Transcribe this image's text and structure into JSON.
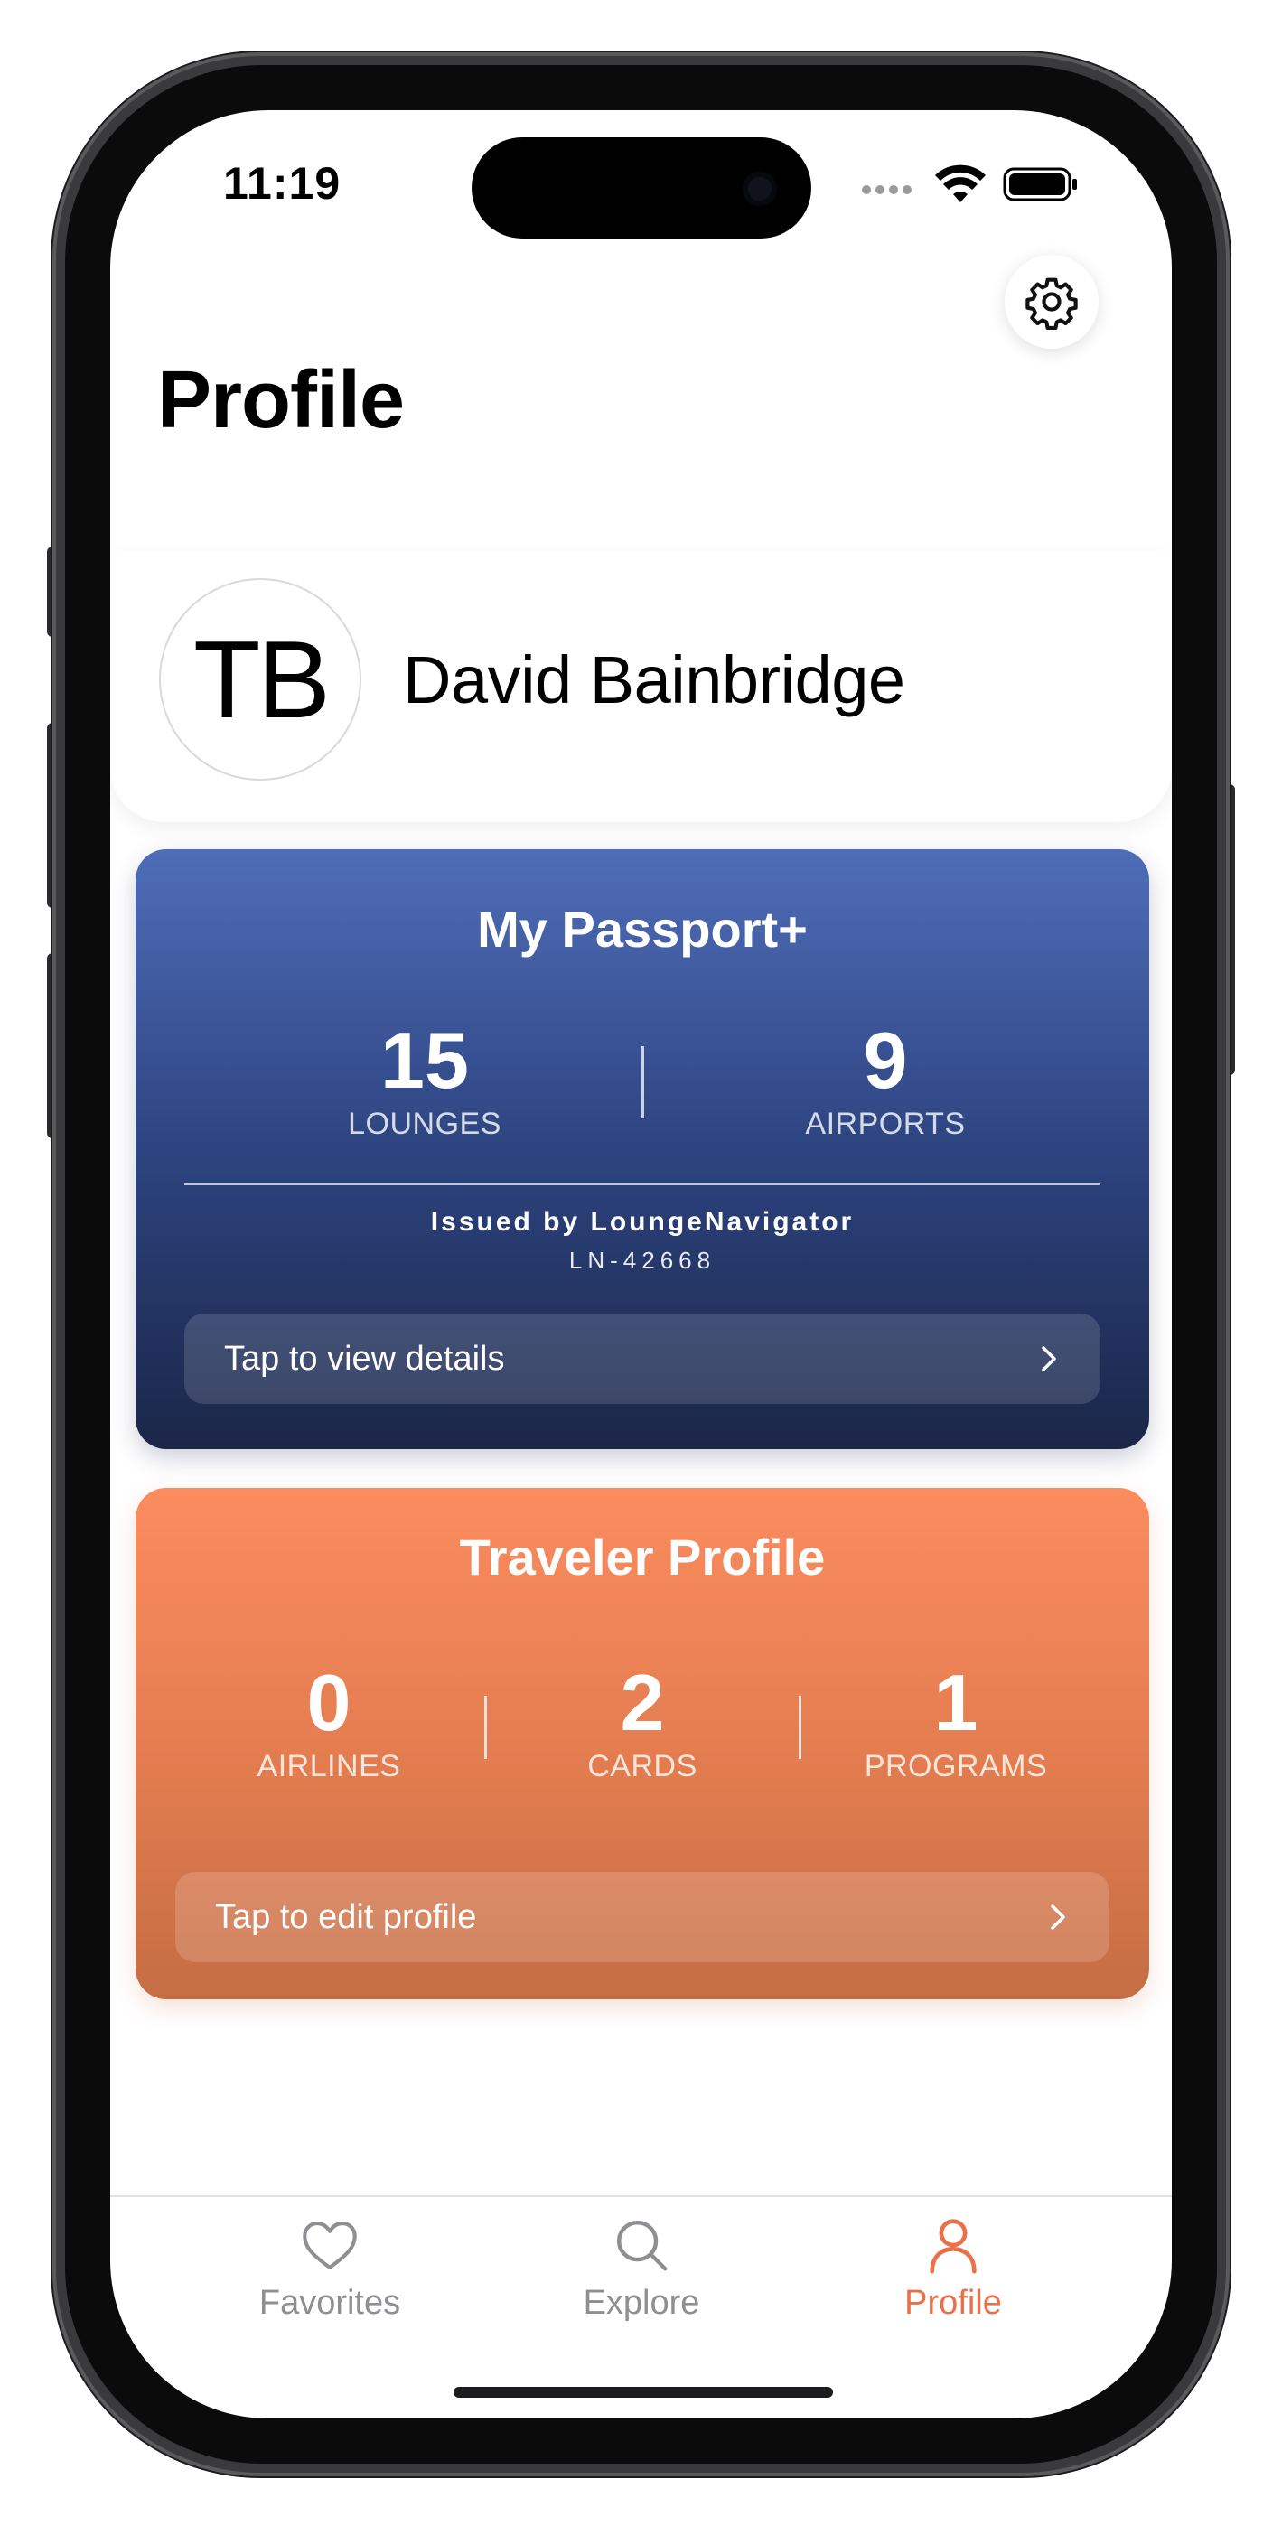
{
  "status_bar": {
    "time": "11:19"
  },
  "header": {
    "title": "Profile",
    "settings_icon": "gear-icon"
  },
  "user": {
    "initials": "TB",
    "name": "David Bainbridge"
  },
  "passport_card": {
    "title": "My Passport+",
    "stats": [
      {
        "value": "15",
        "label": "LOUNGES"
      },
      {
        "value": "9",
        "label": "AIRPORTS"
      }
    ],
    "issued_by": "Issued by LoungeNavigator",
    "passport_id": "LN-42668",
    "action_label": "Tap to view details",
    "colors": {
      "top": "#4f6db8",
      "bottom": "#1b2648"
    }
  },
  "traveler_card": {
    "title": "Traveler Profile",
    "stats": [
      {
        "value": "0",
        "label": "AIRLINES"
      },
      {
        "value": "2",
        "label": "CARDS"
      },
      {
        "value": "1",
        "label": "PROGRAMS"
      }
    ],
    "action_label": "Tap to edit profile",
    "colors": {
      "top": "#fb8c5f",
      "bottom": "#c56d44"
    }
  },
  "tab_bar": {
    "tabs": [
      {
        "label": "Favorites",
        "icon": "heart-icon",
        "active": false
      },
      {
        "label": "Explore",
        "icon": "search-icon",
        "active": false
      },
      {
        "label": "Profile",
        "icon": "person-icon",
        "active": true
      }
    ],
    "active_color": "#e8714a",
    "inactive_color": "#8e8e93"
  }
}
